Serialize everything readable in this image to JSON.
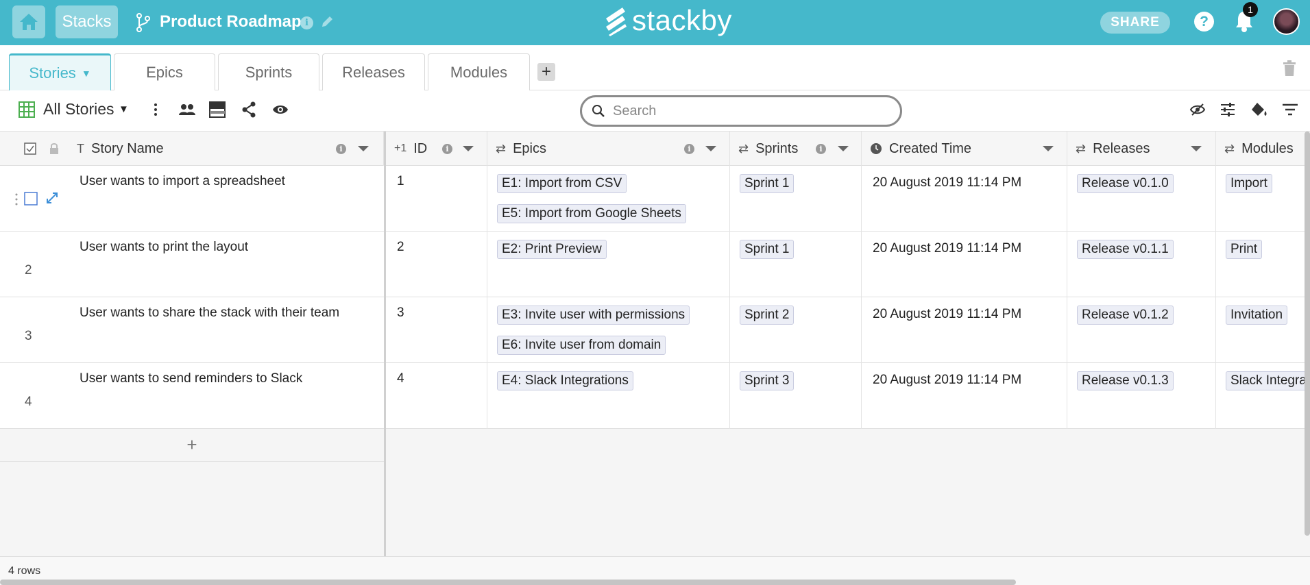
{
  "header": {
    "stacks_label": "Stacks",
    "project_title": "Product Roadmap",
    "logo_text": "stackby",
    "share_label": "SHARE",
    "help_label": "?",
    "notification_count": "1",
    "info_label": "i"
  },
  "tabs": [
    {
      "label": "Stories",
      "active": true
    },
    {
      "label": "Epics"
    },
    {
      "label": "Sprints"
    },
    {
      "label": "Releases"
    },
    {
      "label": "Modules"
    }
  ],
  "add_tab_label": "+",
  "toolbar": {
    "view_name": "All Stories",
    "search_placeholder": "Search"
  },
  "columns": {
    "story_name": "Story Name",
    "id_prefix": "+1",
    "id": "ID",
    "epics": "Epics",
    "sprints": "Sprints",
    "created_time": "Created Time",
    "releases": "Releases",
    "modules": "Modules"
  },
  "rows": [
    {
      "num": "",
      "story": "User wants to import a spreadsheet",
      "id": "1",
      "epics": [
        "E1: Import from CSV",
        "E5: Import from Google Sheets"
      ],
      "sprint": "Sprint 1",
      "created": "20 August 2019 11:14 PM",
      "release": "Release v0.1.0",
      "module": "Import"
    },
    {
      "num": "2",
      "story": "User wants to print the layout",
      "id": "2",
      "epics": [
        "E2: Print Preview"
      ],
      "sprint": "Sprint 1",
      "created": "20 August 2019 11:14 PM",
      "release": "Release v0.1.1",
      "module": "Print"
    },
    {
      "num": "3",
      "story": "User wants to share the stack with their team",
      "id": "3",
      "epics": [
        "E3: Invite user with permissions",
        "E6: Invite user from domain"
      ],
      "sprint": "Sprint 2",
      "created": "20 August 2019 11:14 PM",
      "release": "Release v0.1.2",
      "module": "Invitation"
    },
    {
      "num": "4",
      "story": "User wants to send reminders to Slack",
      "id": "4",
      "epics": [
        "E4: Slack Integrations"
      ],
      "sprint": "Sprint 3",
      "created": "20 August 2019 11:14 PM",
      "release": "Release v0.1.3",
      "module": "Slack Integra"
    }
  ],
  "add_row_label": "+",
  "footer": {
    "row_count": "4 rows"
  },
  "colors": {
    "brand": "#45b8cb",
    "brand_light": "#8fd4df",
    "tag_bg": "#eceef6"
  }
}
